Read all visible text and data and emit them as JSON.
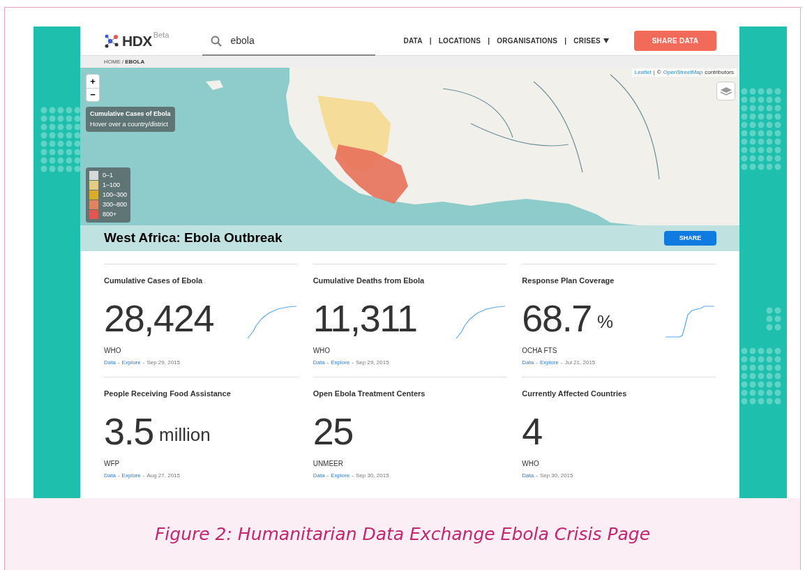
{
  "header": {
    "logo": "HDX",
    "logo_badge": "Beta",
    "search": {
      "value": "ebola"
    },
    "nav": [
      {
        "label": "DATA",
        "dropdown": false
      },
      {
        "label": "LOCATIONS",
        "dropdown": false
      },
      {
        "label": "ORGANISATIONS",
        "dropdown": false
      },
      {
        "label": "CRISES",
        "dropdown": true
      }
    ],
    "nav_separator": "|",
    "cta": "SHARE DATA"
  },
  "breadcrumb_separator": "/",
  "breadcrumb": [
    {
      "label": "HOME",
      "current": false
    },
    {
      "label": "EBOLA",
      "current": true
    }
  ],
  "map": {
    "zoom_in": "+",
    "zoom_out": "−",
    "info": {
      "title": "Cumulative Cases of Ebola",
      "hint": "Hover over a country/district"
    },
    "legend": [
      {
        "label": "0–1",
        "color": "#d5d9da"
      },
      {
        "label": "1–100",
        "color": "#e3cd85"
      },
      {
        "label": "100–300",
        "color": "#d9ac2c"
      },
      {
        "label": "300–800",
        "color": "#e0835f"
      },
      {
        "label": "800+",
        "color": "#e0574f"
      }
    ],
    "attribution": {
      "link1": "Leaflet",
      "separator": "|",
      "prefix": "©",
      "link2": "OpenStreetMap",
      "suffix": "contributors"
    }
  },
  "title": "West Africa: Ebola Outbreak",
  "share": "SHARE",
  "stats": [
    {
      "title": "Cumulative Cases of Ebola",
      "value": "28,424",
      "source": "WHO",
      "links": [
        "Data",
        "Explore"
      ],
      "date": "Sep 29, 2015",
      "kind": "curve"
    },
    {
      "title": "Cumulative Deaths from Ebola",
      "value": "11,311",
      "source": "WHO",
      "links": [
        "Data",
        "Explore"
      ],
      "date": "Sep 29, 2015",
      "kind": "curve"
    },
    {
      "title": "Response Plan Coverage",
      "value": "68.7",
      "unit": "%",
      "source": "OCHA FTS",
      "links": [
        "Data",
        "Explore"
      ],
      "date": "Jul 21, 2015",
      "kind": "step"
    },
    {
      "title": "People Receiving Food Assistance",
      "value": "3.5",
      "unit": "million",
      "source": "WFP",
      "links": [
        "Data",
        "Explore"
      ],
      "date": "Aug 27, 2015",
      "kind": "plain"
    },
    {
      "title": "Open Ebola Treatment Centers",
      "value": "25",
      "source": "UNMEER",
      "links": [
        "Data",
        "Explore"
      ],
      "date": "Sep 30, 2015",
      "kind": "plain"
    },
    {
      "title": "Currently Affected Countries",
      "value": "4",
      "source": "WHO",
      "links": [
        "Data"
      ],
      "date": "Sep 30, 2015",
      "kind": "plain"
    }
  ],
  "link_separator": "-",
  "caption": "Figure 2: Humanitarian Data Exchange Ebola Crisis Page"
}
